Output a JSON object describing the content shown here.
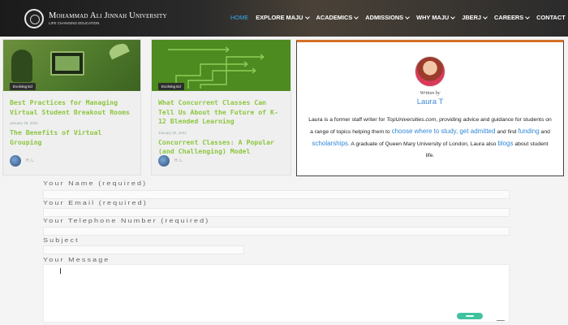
{
  "header": {
    "brand_name": "Mohammad Ali Jinnah University",
    "brand_tagline": "LIFE CHANGING EDUCATION",
    "nav": [
      {
        "label": "HOME",
        "active": true,
        "dropdown": false
      },
      {
        "label": "EXPLORE MAJU",
        "active": false,
        "dropdown": true
      },
      {
        "label": "ACADEMICS",
        "active": false,
        "dropdown": true
      },
      {
        "label": "ADMISSIONS",
        "active": false,
        "dropdown": true
      },
      {
        "label": "WHY MAJU",
        "active": false,
        "dropdown": true
      },
      {
        "label": "JBERJ",
        "active": false,
        "dropdown": true
      },
      {
        "label": "CAREERS",
        "active": false,
        "dropdown": true
      },
      {
        "label": "CONTACT",
        "active": false,
        "dropdown": false
      }
    ],
    "search_icon": "search-icon",
    "active_color": "#39a9ea"
  },
  "cards": [
    {
      "tag": "Evolving Ed",
      "title": "Best Practices for Managing Virtual Student Breakout Rooms",
      "date": "January 26, 2022",
      "subtitle": "The Benefits of Virtual Grouping",
      "author": "H. L."
    },
    {
      "tag": "Evolving Ed",
      "title": "What Concurrent Classes Can Tell Us About the Future of K-12 Blended Learning",
      "date": "January 20, 2022",
      "subtitle": "Concurrent Classes: A Popular (and Challenging) Model",
      "author": "H. L."
    }
  ],
  "author_box": {
    "written_by": "Written by",
    "name": "Laura T",
    "bio": {
      "p1": "Laura is a former staff writer for ",
      "publication": "TopUniversities.com",
      "p2": ", providing advice and guidance for students on a range of topics helping them to ",
      "link1": "choose where to study",
      "p3": ", ",
      "link2": "get admitted",
      "p4": " and find ",
      "link3": "funding",
      "p5": " and ",
      "link4": "scholarships",
      "p6": ". A graduate of Queen Mary University of London, Laura also ",
      "link5": "blogs",
      "p7": " about student life."
    },
    "accent_color": "#d6702a",
    "link_color": "#2f88d6"
  },
  "form": {
    "name_label": "Your Name (required)",
    "email_label": "Your Email (required)",
    "phone_label": "Your Telephone Number (required)",
    "subject_label": "Subject",
    "message_label": "Your Message"
  },
  "theme": {
    "title_green": "#8cc63f",
    "send_color": "#3fc2a0"
  }
}
